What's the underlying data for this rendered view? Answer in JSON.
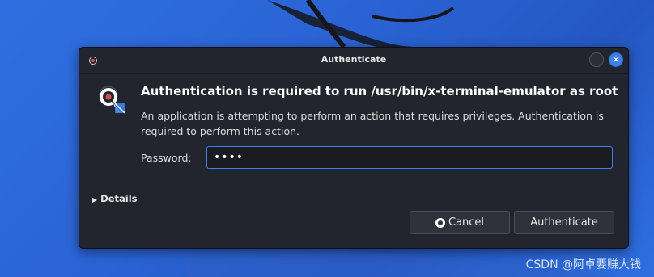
{
  "window": {
    "title": "Authenticate",
    "close_glyph": "✕"
  },
  "dialog": {
    "heading": "Authentication is required to run /usr/bin/x-terminal-emulator as root",
    "description": "An application is attempting to perform an action that requires privileges. Authentication is required to perform this action.",
    "password_label": "Password:",
    "password_value": "••••",
    "details_label": "Details",
    "details_arrow": "▶",
    "cancel_label": "Cancel",
    "authenticate_label": "Authenticate"
  },
  "icons": {
    "app": "app-indicator-icon",
    "lock": "authentication-lock-icon",
    "minimize": "minimize-icon",
    "close": "close-icon",
    "cancel": "cancel-icon",
    "disclosure": "disclosure-triangle-icon"
  },
  "watermark": "CSDN @阿卓要赚大钱",
  "colors": {
    "accent": "#3b82f0",
    "dialog_bg": "#23252e",
    "desktop_bg": "#2a63d4"
  }
}
